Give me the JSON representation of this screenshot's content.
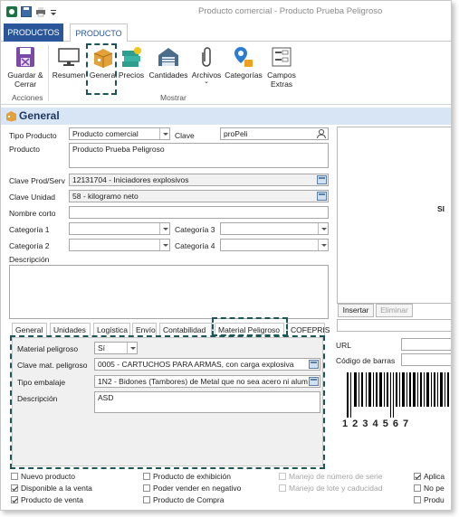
{
  "window": {
    "title": "Producto comercial - Producto Prueba Peligroso"
  },
  "tabs": {
    "productos": "PRODUCTOS",
    "producto": "PRODUCTO"
  },
  "ribbon": {
    "guardar": "Guardar & Cerrar",
    "resumen": "Resumen",
    "general": "General",
    "precios": "Precios",
    "cantidades": "Cantidades",
    "archivos": "Archivos",
    "categorias": "Categorías",
    "campos_extras": "Campos Extras",
    "group_acciones": "Acciones",
    "group_mostrar": "Mostrar"
  },
  "section": {
    "title": "General"
  },
  "form": {
    "tipo_producto_label": "Tipo Producto",
    "tipo_producto_value": "Producto comercial",
    "clave_label": "Clave",
    "clave_value": "proPeli",
    "producto_label": "Producto",
    "producto_value": "Producto Prueba Peligroso",
    "clave_prodserv_label": "Clave Prod/Serv",
    "clave_prodserv_value": "12131704 - Iniciadores explosivos",
    "clave_unidad_label": "Clave Unidad",
    "clave_unidad_value": "58 -  kilogramo neto",
    "nombre_corto_label": "Nombre corto",
    "nombre_corto_value": "",
    "categoria1_label": "Categoría 1",
    "categoria2_label": "Categoría 2",
    "categoria3_label": "Categoría 3",
    "categoria4_label": "Categoría 4",
    "descripcion_label": "Descripción"
  },
  "lower_tabs": [
    "General",
    "Unidades",
    "Logística",
    "Envío",
    "Contabilidad",
    "Material Peligroso",
    "COFEPRIS"
  ],
  "material": {
    "peligroso_label": "Material peligroso",
    "peligroso_value": "Sí",
    "clave_label": "Clave mat. peligroso",
    "clave_value": "0005 - CARTUCHOS PARA ARMAS, con carga explosiva",
    "embalaje_label": "Tipo embalaje",
    "embalaje_value": "1N2 - Bidones (Tambores) de Metal que no sea acero ni alum",
    "descripcion_label": "Descripción",
    "descripcion_value": "ASD"
  },
  "right": {
    "sin_text": "SI",
    "insertar": "Insertar",
    "eliminar": "Eliminar",
    "url_label": "URL",
    "barcode_label": "Código de barras",
    "barcode_digits": "1 2 3 4 5 6 7"
  },
  "checkboxes": {
    "nuevo": "Nuevo producto",
    "disponible": "Disponible a la venta",
    "de_venta": "Producto de venta",
    "exhibicion": "Producto de exhibición",
    "negativo": "Poder vender en negativo",
    "compra": "Producto de Compra",
    "serie": "Manejo de número de serie",
    "lote": "Manejo de lote y caducidad",
    "aplica": "Aplica",
    "no_pe": "No pe",
    "produ": "Produ"
  },
  "colors": {
    "accent": "#2b579a",
    "header_bg": "#d7e5f5",
    "dash": "#1d5656"
  }
}
